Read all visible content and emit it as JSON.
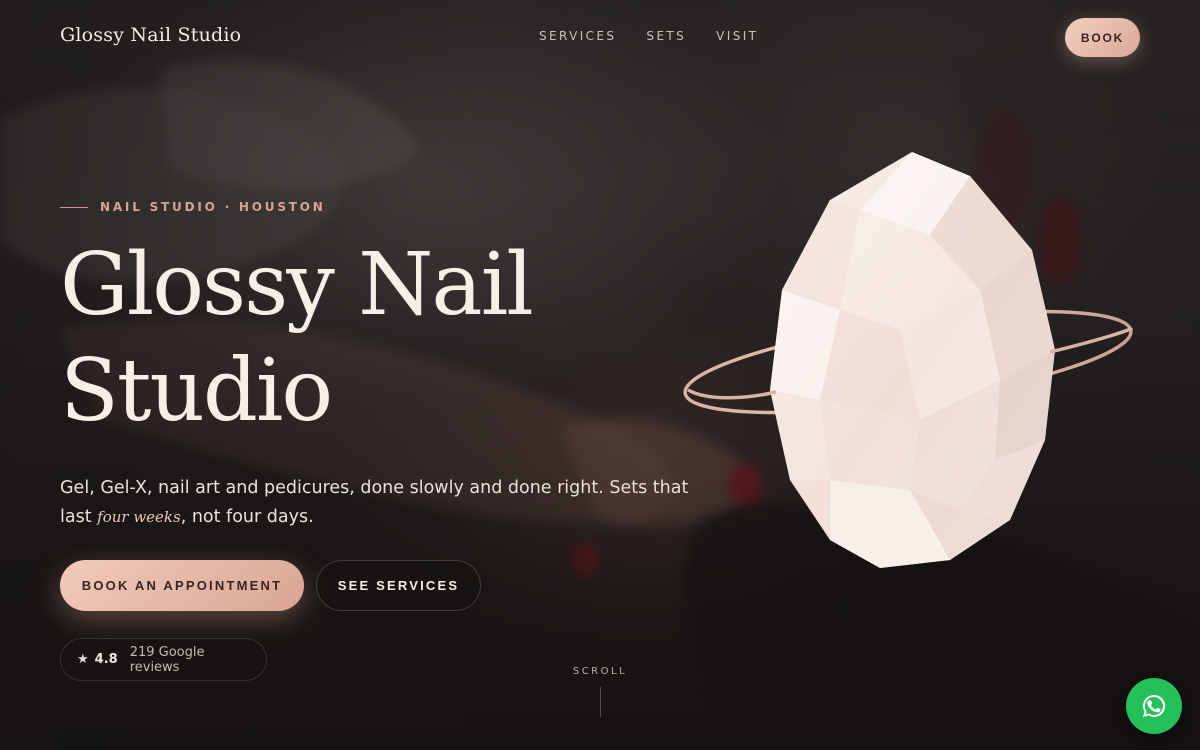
{
  "brand": {
    "name": "Glossy Nail Studio"
  },
  "nav": {
    "items": [
      "SERVICES",
      "SETS",
      "VISIT"
    ]
  },
  "header": {
    "book_label": "BOOK"
  },
  "hero": {
    "eyebrow": "NAIL STUDIO · HOUSTON",
    "title_line1": "Glossy Nail",
    "title_line2": "Studio",
    "lede_part1": "Gel, Gel-X, nail art and pedicures, done slowly and done right. Sets that last ",
    "lede_emphasis": "four weeks",
    "lede_part2": ", not four days.",
    "primary_cta": "BOOK AN APPOINTMENT",
    "secondary_cta": "SEE SERVICES"
  },
  "reviews": {
    "star": "★",
    "rating": "4.8",
    "count_text": "219 Google reviews"
  },
  "scroll": {
    "label": "SCROLL"
  },
  "colors": {
    "accent": "#e0b1a0",
    "whatsapp": "#25c05a",
    "background": "#1c1918"
  },
  "icons": {
    "floating_action": "whatsapp-icon",
    "hero_visual": "gem-ring-graphic"
  }
}
